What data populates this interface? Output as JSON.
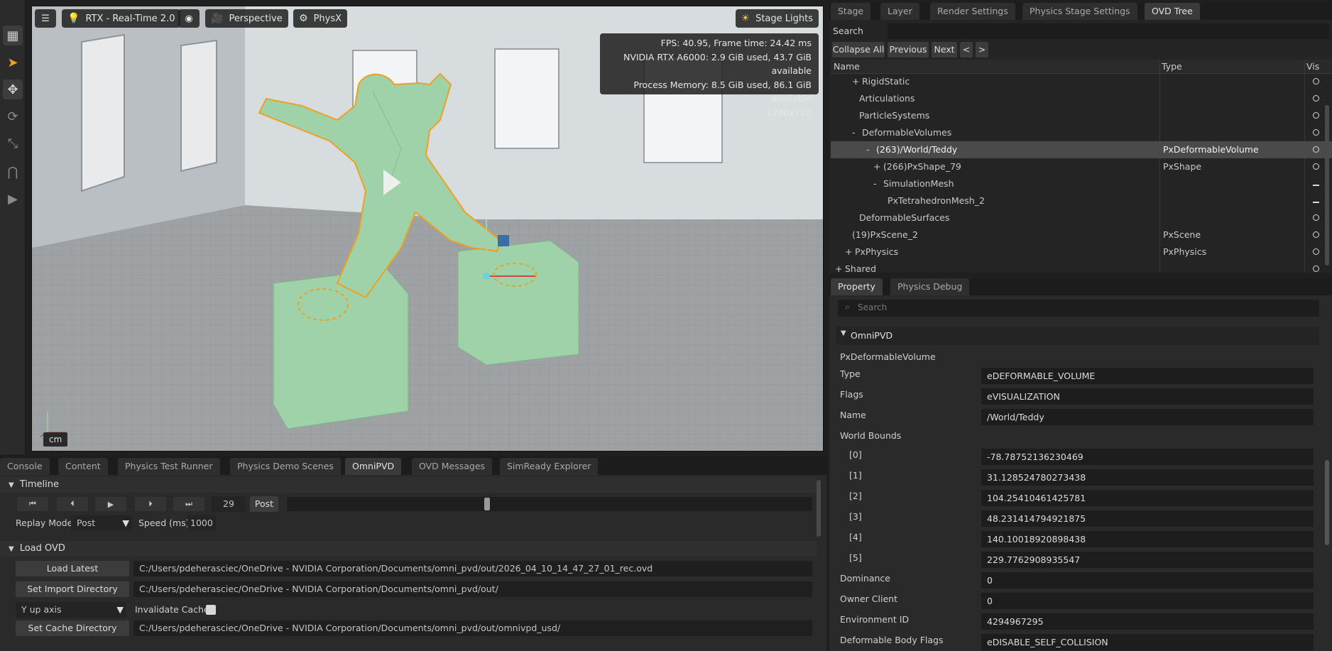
{
  "viewport": {
    "renderer": "RTX - Real-Time 2.0",
    "camera": "Perspective",
    "physics_label": "PhysX",
    "lighting": "Stage Lights",
    "stats": {
      "fps": "FPS: 40.95, Frame time: 24.42 ms",
      "gpu": "NVIDIA RTX A6000: 2.9 GiB used, 43.7 GiB available",
      "memory": "Process Memory: 8.5 GiB used, 86.1 GiB available",
      "resolution": "1280x720"
    },
    "unit": "cm"
  },
  "bottom_tabs": [
    "Console",
    "Content",
    "Physics Test Runner",
    "Physics Demo Scenes",
    "OmniPVD",
    "OVD Messages",
    "SimReady Explorer"
  ],
  "timeline": {
    "title": "Timeline",
    "frame": "29",
    "mode": "Post",
    "replay_label": "Replay Mode",
    "replay_value": "Post",
    "speed_label": "Speed (ms)",
    "speed_value": "1000",
    "slider_position": 0.38
  },
  "load_ovd": {
    "title": "Load OVD",
    "load_latest": "Load Latest",
    "load_path": "C:/Users/pdeherasciec/OneDrive - NVIDIA Corporation/Documents/omni_pvd/out/2026_04_10_14_47_27_01_rec.ovd",
    "import_dir_btn": "Set Import Directory",
    "import_path": "C:/Users/pdeherasciec/OneDrive - NVIDIA Corporation/Documents/omni_pvd/out/",
    "up_axis": "Y up axis",
    "invalidate_cache": "Invalidate Cache",
    "cache_dir_btn": "Set Cache Directory",
    "cache_path": "C:/Users/pdeherasciec/OneDrive - NVIDIA Corporation/Documents/omni_pvd/out/omnivpd_usd/"
  },
  "right_tabs": [
    "Stage",
    "Layer",
    "Render Settings",
    "Physics Stage Settings",
    "OVD Tree"
  ],
  "tree": {
    "search_label": "Search",
    "buttons": [
      "Collapse All",
      "Previous",
      "Next",
      "<",
      ">"
    ],
    "columns": [
      "Name",
      "Type",
      "Vis"
    ],
    "rows": [
      {
        "prefix": "+",
        "name": "RigidStatic",
        "type": "",
        "vis": "dot"
      },
      {
        "prefix": "",
        "name": "Articulations",
        "type": "",
        "vis": "dot"
      },
      {
        "prefix": "",
        "name": "ParticleSystems",
        "type": "",
        "vis": "dot"
      },
      {
        "prefix": "-",
        "name": "DeformableVolumes",
        "type": "",
        "vis": "dot"
      },
      {
        "prefix": "-",
        "name": "(263)/World/Teddy",
        "type": "PxDeformableVolume",
        "vis": "dot"
      },
      {
        "prefix": "+",
        "name": "(266)PxShape_79",
        "type": "PxShape",
        "vis": "dot"
      },
      {
        "prefix": "-",
        "name": "SimulationMesh",
        "type": "",
        "vis": "dash"
      },
      {
        "prefix": "",
        "name": "PxTetrahedronMesh_2",
        "type": "",
        "vis": "dash"
      },
      {
        "prefix": "",
        "name": "DeformableSurfaces",
        "type": "",
        "vis": "dot"
      },
      {
        "prefix": "",
        "name": "(19)PxScene_2",
        "type": "PxScene",
        "vis": "dot"
      },
      {
        "prefix": "+",
        "name": "PxPhysics",
        "type": "PxPhysics",
        "vis": "dot"
      },
      {
        "prefix": "+",
        "name": "Shared",
        "type": "",
        "vis": "dot"
      }
    ]
  },
  "prop_tabs": [
    "Property",
    "Physics Debug"
  ],
  "property": {
    "search_placeholder": "Search",
    "section": "OmniPVD",
    "object_class": "PxDeformableVolume",
    "fields": [
      {
        "label": "Type",
        "value": "eDEFORMABLE_VOLUME"
      },
      {
        "label": "Flags",
        "value": "eVISUALIZATION"
      },
      {
        "label": "Name",
        "value": "/World/Teddy"
      }
    ],
    "bounds_label": "World Bounds",
    "bounds": [
      {
        "label": "[0]",
        "value": "-78.78752136230469"
      },
      {
        "label": "[1]",
        "value": "31.128524780273438"
      },
      {
        "label": "[2]",
        "value": "104.25410461425781"
      },
      {
        "label": "[3]",
        "value": "48.231414794921875"
      },
      {
        "label": "[4]",
        "value": "140.10018920898438"
      },
      {
        "label": "[5]",
        "value": "229.7762908935547"
      }
    ],
    "extra": [
      {
        "label": "Dominance",
        "value": "0"
      },
      {
        "label": "Owner Client",
        "value": "0"
      },
      {
        "label": "Environment ID",
        "value": "4294967295"
      },
      {
        "label": "Deformable Body Flags",
        "value": "eDISABLE_SELF_COLLISION"
      }
    ]
  },
  "colors": {
    "accent_outline": "#f0a020",
    "teddy_fill": "#9fd2a8",
    "selection_row": "#4a4a4a"
  }
}
